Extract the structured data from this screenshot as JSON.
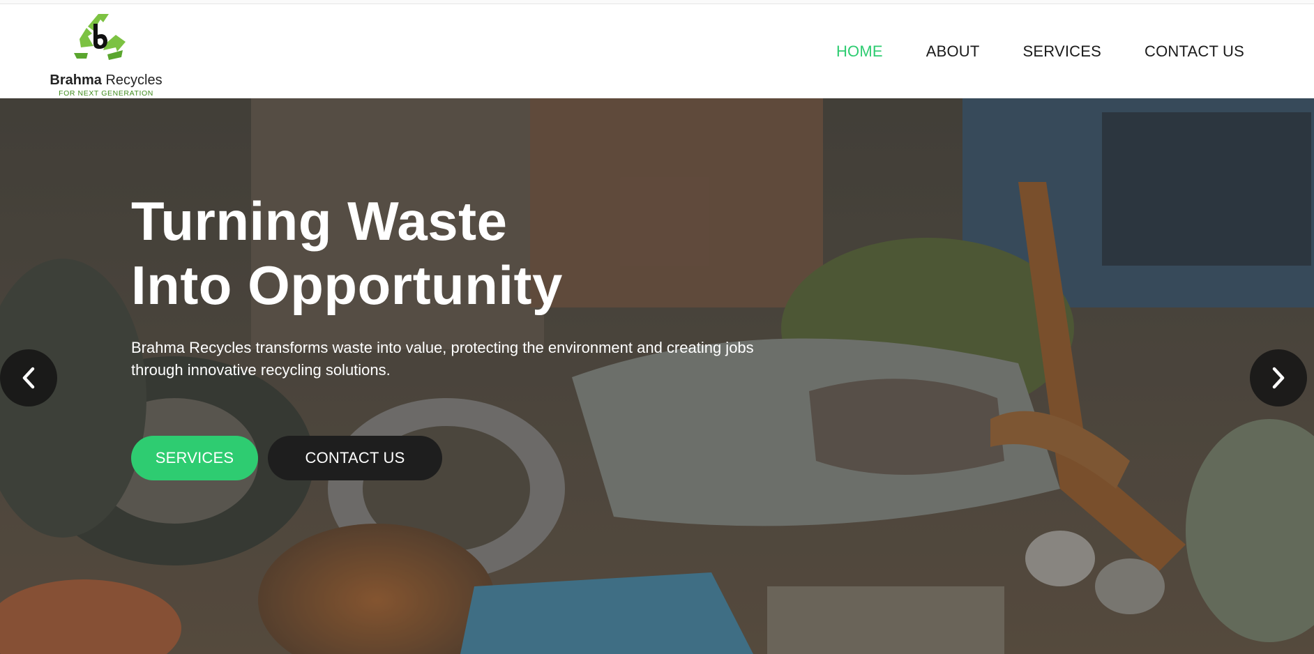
{
  "brand": {
    "name_bold": "Brahma",
    "name_rest": " Recycles",
    "tagline": "FOR NEXT GENERATION",
    "logo_icon": "recycle-logo-icon"
  },
  "nav": {
    "items": [
      {
        "label": "HOME",
        "active": true
      },
      {
        "label": "ABOUT",
        "active": false
      },
      {
        "label": "SERVICES",
        "active": false
      },
      {
        "label": "CONTACT US",
        "active": false
      }
    ]
  },
  "hero": {
    "title_line1": "Turning Waste",
    "title_line2": "Into Opportunity",
    "subtitle": "Brahma Recycles transforms waste into value, protecting the environment and creating jobs through innovative recycling solutions.",
    "primary_button": "SERVICES",
    "secondary_button": "CONTACT US",
    "prev_icon": "chevron-left-icon",
    "next_icon": "chevron-right-icon"
  },
  "colors": {
    "accent": "#2ecc71",
    "dark_button": "#1e1e1e",
    "logo_green": "#7cc242"
  }
}
